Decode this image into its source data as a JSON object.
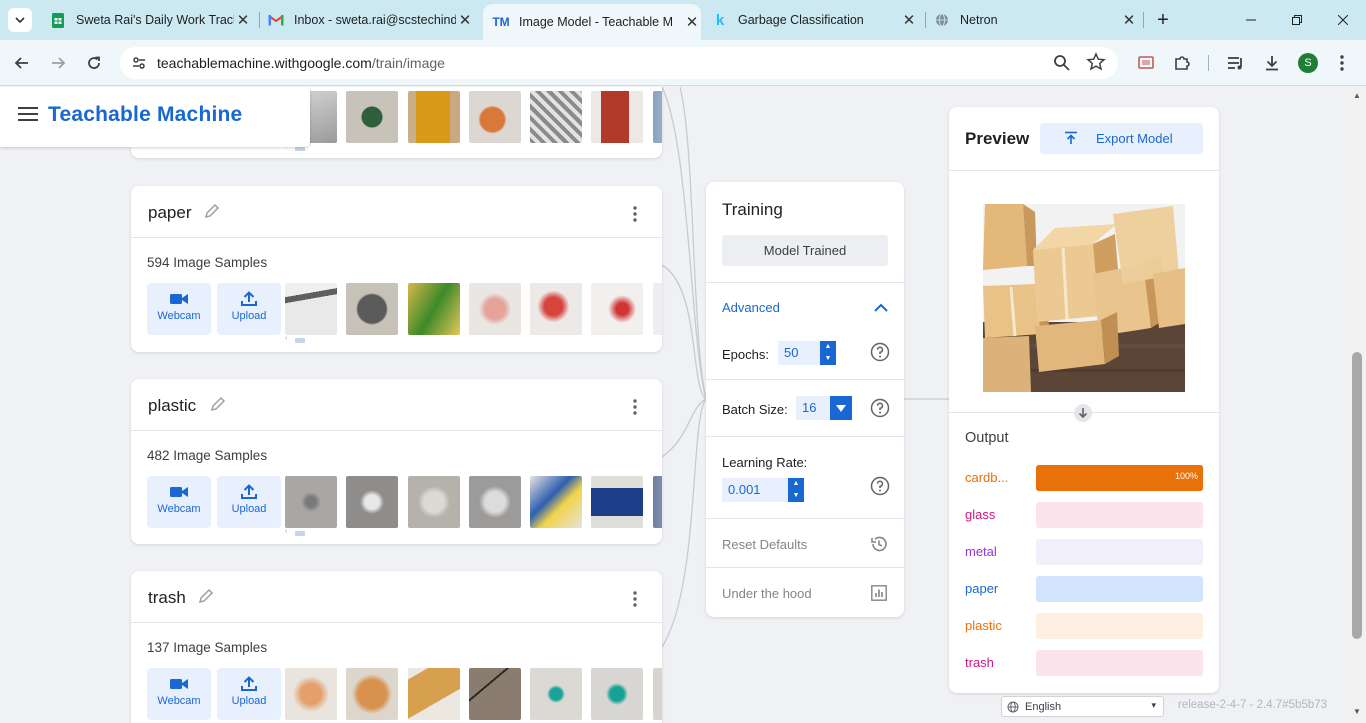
{
  "browser": {
    "tabs": [
      {
        "title": "Sweta Rai's Daily Work Track",
        "favicon": "sheets-icon",
        "active": false
      },
      {
        "title": "Inbox - sweta.rai@scstechind",
        "favicon": "gmail-icon",
        "active": false
      },
      {
        "title": "Image Model - Teachable M",
        "favicon": "tm-icon",
        "favicon_text": "TM",
        "active": true
      },
      {
        "title": "Garbage Classification",
        "favicon": "kaggle-icon",
        "favicon_text": "k",
        "active": false
      },
      {
        "title": "Netron",
        "favicon": "globe-icon",
        "active": false
      }
    ],
    "new_tab": "+",
    "url_host": "teachablemachine.withgoogle.com",
    "url_path": "/train/image",
    "profile_initial": "S"
  },
  "app": {
    "brand": "Teachable Machine"
  },
  "classes": [
    {
      "name": "paper",
      "count": "594 Image Samples",
      "webcam": "Webcam",
      "upload": "Upload"
    },
    {
      "name": "plastic",
      "count": "482 Image Samples",
      "webcam": "Webcam",
      "upload": "Upload"
    },
    {
      "name": "trash",
      "count": "137 Image Samples",
      "webcam": "Webcam",
      "upload": "Upload"
    }
  ],
  "training": {
    "title": "Training",
    "status_button": "Model Trained",
    "advanced": "Advanced",
    "epochs_label": "Epochs:",
    "epochs_value": "50",
    "batch_label": "Batch Size:",
    "batch_value": "16",
    "lr_label": "Learning Rate:",
    "lr_value": "0.001",
    "reset": "Reset Defaults",
    "under_hood": "Under the hood"
  },
  "preview": {
    "title": "Preview",
    "export": "Export Model",
    "output_title": "Output",
    "outputs": [
      {
        "label": "cardb...",
        "percent": 100,
        "percent_label": "100%",
        "color": "#e8710a",
        "track": "#e8710a"
      },
      {
        "label": "glass",
        "percent": 0,
        "percent_label": "",
        "color": "#d01884",
        "track": "#fce4ec"
      },
      {
        "label": "metal",
        "percent": 0,
        "percent_label": "",
        "color": "#9334e6",
        "track": "#f0effb"
      },
      {
        "label": "paper",
        "percent": 0,
        "percent_label": "",
        "color": "#1967d2",
        "track": "#d2e3fc"
      },
      {
        "label": "plastic",
        "percent": 0,
        "percent_label": "",
        "color": "#e8710a",
        "track": "#feefe3"
      },
      {
        "label": "trash",
        "percent": 0,
        "percent_label": "",
        "color": "#d01884",
        "track": "#fce4ec"
      }
    ]
  },
  "footer": {
    "language": "English",
    "release": "release-2-4-7 - 2.4.7#5b5b73"
  },
  "colors": {
    "accent": "#1967d2",
    "tabstrip": "#cce8f1",
    "page_bg": "#f0f1f4"
  }
}
